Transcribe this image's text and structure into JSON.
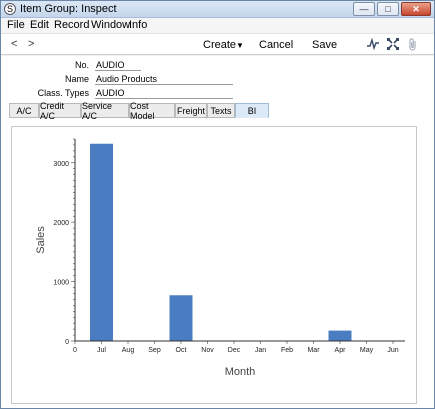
{
  "window": {
    "title": "Item Group: Inspect"
  },
  "menu": [
    "File",
    "Edit",
    "Record",
    "Window",
    "Info"
  ],
  "toolbar": {
    "back": "<",
    "forward": ">",
    "create": "Create",
    "cancel": "Cancel",
    "save": "Save"
  },
  "form": {
    "no_label": "No.",
    "no_value": "AUDIO",
    "name_label": "Name",
    "name_value": "Audio Products",
    "class_label": "Class. Types",
    "class_value": "AUDIO"
  },
  "tabs": [
    "A/C",
    "Credit A/C",
    "Service A/C",
    "Cost Model",
    "Freight",
    "Texts",
    "BI"
  ],
  "active_tab": "BI",
  "chart_data": {
    "type": "bar",
    "categories": [
      "Jul",
      "Aug",
      "Sep",
      "Oct",
      "Nov",
      "Dec",
      "Jan",
      "Feb",
      "Mar",
      "Apr",
      "May",
      "Jun"
    ],
    "values": [
      3320,
      0,
      0,
      770,
      0,
      0,
      0,
      0,
      0,
      175,
      0,
      0
    ],
    "xlabel": "Month",
    "ylabel": "Sales",
    "x_zero_label": "0",
    "ylim": [
      0,
      3400
    ],
    "yticks": [
      0,
      1000,
      2000,
      3000
    ],
    "bar_color": "#4a7cc1",
    "grid": false,
    "legend": "none"
  }
}
